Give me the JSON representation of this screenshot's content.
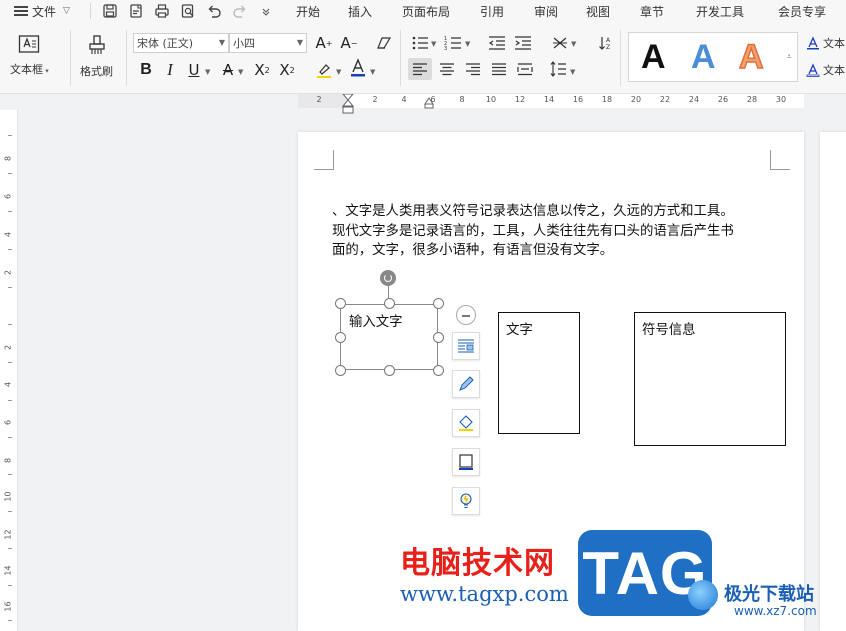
{
  "menu": {
    "file_label": "文件",
    "tabs": [
      "开始",
      "插入",
      "页面布局",
      "引用",
      "审阅",
      "视图",
      "章节",
      "开发工具",
      "会员专享"
    ]
  },
  "ribbon": {
    "textbox_label": "文本框",
    "format_painter_label": "格式刷",
    "font_name": "宋体 (正文)",
    "font_size": "小四",
    "style_letters": [
      "A",
      "A",
      "A"
    ],
    "style_colors": [
      "#111111",
      "#4a8fd6",
      "#f0a070"
    ],
    "side_text_1": "文本",
    "side_text_2": "文本"
  },
  "ruler": {
    "h_numbers": [
      "2",
      "2",
      "4",
      "6",
      "8",
      "10",
      "12",
      "14",
      "16",
      "18",
      "20",
      "22",
      "24",
      "26",
      "28",
      "30"
    ],
    "v_numbers": [
      "8",
      "6",
      "4",
      "2",
      "2",
      "4",
      "6",
      "8",
      "10",
      "12",
      "14",
      "16"
    ]
  },
  "document": {
    "lines": [
      "、文字是人类用表义符号记录表达信息以传之，久远的方式和工具。",
      "现代文字多是记录语言的，工具，人类往往先有口头的语言后产生书",
      "面的，文字，很多小语种，有语言但没有文字。"
    ],
    "selected_textbox_text": "输入文字",
    "box1_text": "文字",
    "box2_text": "符号信息"
  },
  "watermark": {
    "site_name": "电脑技术网",
    "site_url": "www.tagxp.com",
    "logo_text": "TAG",
    "brand_name": "极光下载站",
    "brand_url": "www.xz7.com"
  }
}
